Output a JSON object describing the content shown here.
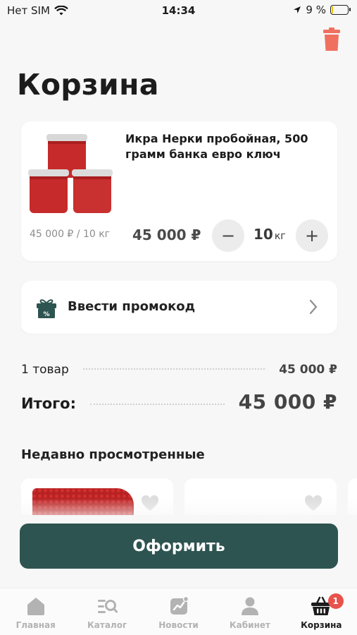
{
  "status_bar": {
    "carrier": "Нет SIM",
    "time": "14:34",
    "battery_percent": "9 %",
    "battery_level": 0.09
  },
  "page": {
    "title": "Корзина"
  },
  "cart_item": {
    "name": "Икра Нерки пробойная, 500 грамм банка евро ключ",
    "unit_price": "45 000 ₽ / 10 кг",
    "total_price": "45 000 ₽",
    "quantity": "10",
    "quantity_unit": "кг",
    "minus_label": "−",
    "plus_label": "+"
  },
  "promo": {
    "label": "Ввести промокод"
  },
  "summary": {
    "items_label": "1 товар",
    "items_value": "45 000 ₽",
    "total_label": "Итого:",
    "total_value": "45 000 ₽"
  },
  "recent": {
    "title": "Недавно просмотренные"
  },
  "checkout": {
    "label": "Оформить"
  },
  "tabs": [
    {
      "label": "Главная",
      "icon": "home-icon",
      "active": false
    },
    {
      "label": "Каталог",
      "icon": "catalog-search-icon",
      "active": false
    },
    {
      "label": "Новости",
      "icon": "news-icon",
      "active": false
    },
    {
      "label": "Кабинет",
      "icon": "user-icon",
      "active": false
    },
    {
      "label": "Корзина",
      "icon": "basket-icon",
      "active": true,
      "badge": "1"
    }
  ],
  "colors": {
    "accent": "#2d5450",
    "danger": "#e8524b",
    "trash": "#f07060"
  }
}
